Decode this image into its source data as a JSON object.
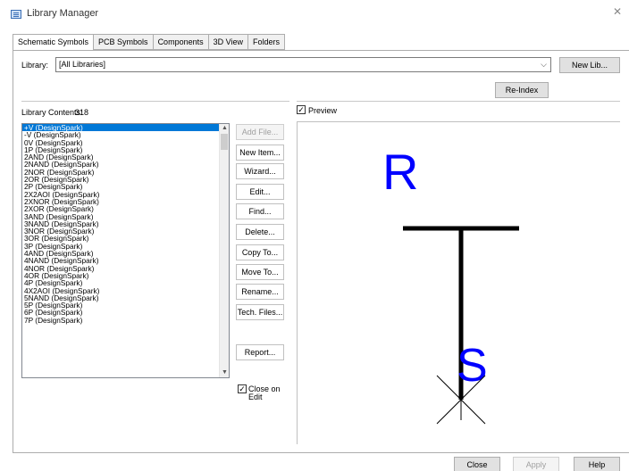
{
  "window": {
    "title": "Library Manager"
  },
  "tabs": [
    "Schematic Symbols",
    "PCB Symbols",
    "Components",
    "3D View",
    "Folders"
  ],
  "library": {
    "label": "Library:",
    "value": "[All Libraries]",
    "new_lib": "New Lib...",
    "reindex": "Re-Index"
  },
  "contents": {
    "label": "Library Contents:",
    "count": "318"
  },
  "preview_label": "Preview",
  "items": [
    "+V (DesignSpark)",
    "-V (DesignSpark)",
    "0V (DesignSpark)",
    "1P (DesignSpark)",
    "2AND (DesignSpark)",
    "2NAND (DesignSpark)",
    "2NOR (DesignSpark)",
    "2OR (DesignSpark)",
    "2P (DesignSpark)",
    "2X2AOI (DesignSpark)",
    "2XNOR (DesignSpark)",
    "2XOR (DesignSpark)",
    "3AND (DesignSpark)",
    "3NAND (DesignSpark)",
    "3NOR (DesignSpark)",
    "3OR (DesignSpark)",
    "3P (DesignSpark)",
    "4AND (DesignSpark)",
    "4NAND (DesignSpark)",
    "4NOR (DesignSpark)",
    "4OR (DesignSpark)",
    "4P (DesignSpark)",
    "4X2AOI (DesignSpark)",
    "5NAND (DesignSpark)",
    "5P (DesignSpark)",
    "6P (DesignSpark)",
    "7P (DesignSpark)"
  ],
  "buttons": {
    "add_file": "Add File...",
    "new_item": "New Item...",
    "wizard": "Wizard...",
    "edit": "Edit...",
    "find": "Find...",
    "delete": "Delete...",
    "copy_to": "Copy To...",
    "move_to": "Move To...",
    "rename": "Rename...",
    "tech_files": "Tech. Files...",
    "report": "Report..."
  },
  "close_on_edit": {
    "line1": "Close on",
    "line2": "Edit"
  },
  "preview_glyphs": {
    "top": "R",
    "bottom": "S"
  },
  "footer": {
    "close": "Close",
    "apply": "Apply",
    "help": "Help"
  },
  "colors": {
    "selection": "#0078d7",
    "symbol_text": "#0000ff",
    "symbol_line": "#000000"
  }
}
